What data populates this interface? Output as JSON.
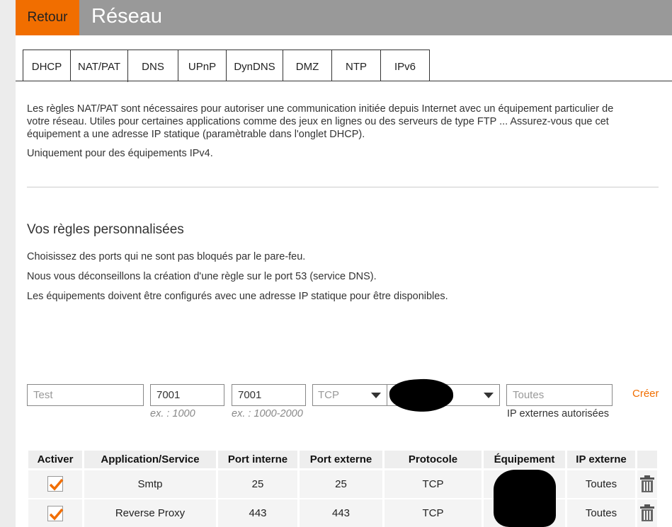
{
  "header": {
    "back_label": "Retour",
    "title": "Réseau"
  },
  "tabs": [
    {
      "label": "DHCP"
    },
    {
      "label": "NAT/PAT"
    },
    {
      "label": "DNS"
    },
    {
      "label": "UPnP"
    },
    {
      "label": "DynDNS"
    },
    {
      "label": "DMZ"
    },
    {
      "label": "NTP"
    },
    {
      "label": "IPv6"
    }
  ],
  "active_tab": "NAT/PAT",
  "intro": {
    "line1": "Les règles NAT/PAT sont nécessaires pour autoriser une communication initiée depuis Internet avec un équipement particulier de",
    "line2": "votre réseau. Utiles pour certaines applications comme des jeux en lignes ou des serveurs de type FTP ... Assurez-vous que cet",
    "line3": "équipement a une adresse IP statique (paramètrable dans l'onglet DHCP).",
    "ipv4_note": "Uniquement pour des équipements IPv4."
  },
  "custom_rules": {
    "title": "Vos règles personnalisées",
    "note1": "Choisissez des ports qui ne sont pas bloqués par le pare-feu.",
    "note2": "Nous vous déconseillons la création d'une règle sur le port 53 (service DNS).",
    "note3": "Les équipements doivent être configurés avec une adresse IP statique pour être disponibles."
  },
  "form": {
    "service_placeholder": "Test",
    "internal_port_value": "7001",
    "internal_port_hint": "ex. : 1000",
    "external_port_value": "7001",
    "external_port_hint": "ex. : 1000-2000",
    "protocol_value": "TCP",
    "external_ip_placeholder": "Toutes",
    "external_ip_hint": "IP externes autorisées",
    "create_label": "Créer"
  },
  "table": {
    "headers": [
      "Activer",
      "Application/Service",
      "Port interne",
      "Port externe",
      "Protocole",
      "Équipement",
      "IP externe"
    ],
    "rows": [
      {
        "enabled": true,
        "service": "Smtp",
        "internal_port": "25",
        "external_port": "25",
        "protocol": "TCP",
        "external_ip": "Toutes"
      },
      {
        "enabled": true,
        "service": "Reverse Proxy",
        "internal_port": "443",
        "external_port": "443",
        "protocol": "TCP",
        "external_ip": "Toutes"
      }
    ]
  },
  "colors": {
    "accent": "#f16e00",
    "header_bg": "#999999"
  },
  "icons": {
    "checkbox": "checkmark-icon",
    "delete": "trash-icon",
    "dropdown": "caret-down-icon"
  }
}
